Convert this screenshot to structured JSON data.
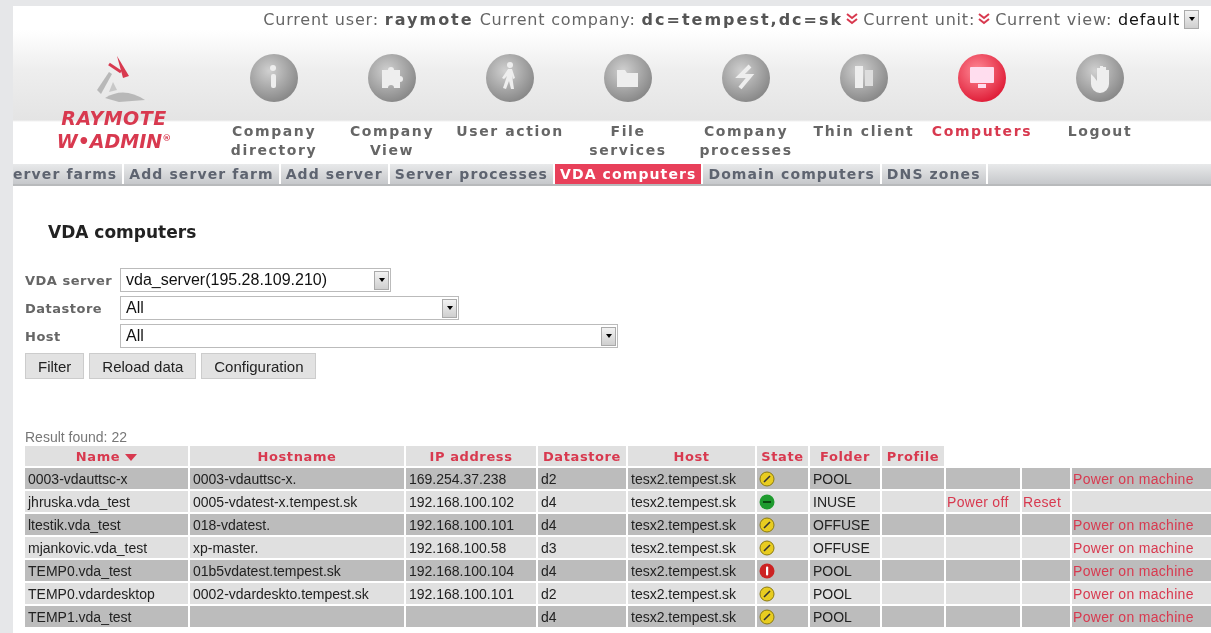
{
  "header": {
    "user_label": "Current user:",
    "user": "raymote",
    "company_label": "Current company:",
    "company": "dc=tempest,dc=sk",
    "unit_label": "Current unit:",
    "view_label": "Current view:",
    "view": "default"
  },
  "logo": {
    "line1": "RAYMOTE",
    "line2": "W•ADMIN",
    "mark": "®"
  },
  "nav": [
    {
      "label": "Company directory",
      "selected": false
    },
    {
      "label": "Company View",
      "selected": false
    },
    {
      "label": "User action",
      "selected": false
    },
    {
      "label": "File services",
      "selected": false
    },
    {
      "label": "Company processes",
      "selected": false
    },
    {
      "label": "Thin client",
      "selected": false
    },
    {
      "label": "Computers",
      "selected": true
    },
    {
      "label": "Logout",
      "selected": false
    }
  ],
  "subnav": [
    {
      "label": "erver farms",
      "selected": false
    },
    {
      "label": "Add server farm",
      "selected": false
    },
    {
      "label": "Add server",
      "selected": false
    },
    {
      "label": "Server processes",
      "selected": false
    },
    {
      "label": "VDA computers",
      "selected": true
    },
    {
      "label": "Domain computers",
      "selected": false
    },
    {
      "label": "DNS zones",
      "selected": false
    }
  ],
  "title": "VDA computers",
  "filters": [
    {
      "label": "VDA server",
      "value": "vda_server(195.28.109.210)"
    },
    {
      "label": "Datastore",
      "value": "All"
    },
    {
      "label": "Host",
      "value": "All"
    }
  ],
  "buttons": [
    "Filter",
    "Reload data",
    "Configuration"
  ],
  "result": "Result found: 22",
  "table": {
    "columns": [
      {
        "label": "Name",
        "sorted": true
      },
      {
        "label": "Hostname",
        "sorted": false
      },
      {
        "label": "IP address",
        "sorted": false
      },
      {
        "label": "Datastore",
        "sorted": false
      },
      {
        "label": "Host",
        "sorted": false
      },
      {
        "label": "State",
        "sorted": false
      },
      {
        "label": "Folder",
        "sorted": false
      },
      {
        "label": "Profile",
        "sorted": false
      }
    ],
    "rows": [
      {
        "name": "0003-vdauttsc-x",
        "hostname": "0003-vdauttsc-x.",
        "ip": "169.254.37.238",
        "datastore": "d2",
        "host": "tesx2.tempest.sk",
        "kind": "suspended",
        "folder": "POOL",
        "power_on": "Power on machine"
      },
      {
        "name": "jhruska.vda_test",
        "hostname": "0005-vdatest-x.tempest.sk",
        "ip": "192.168.100.102",
        "datastore": "d4",
        "host": "tesx2.tempest.sk",
        "kind": "running",
        "folder": "INUSE",
        "power_off": "Power off",
        "reset": "Reset"
      },
      {
        "name": "ltestik.vda_test",
        "hostname": "018-vdatest.",
        "ip": "192.168.100.101",
        "datastore": "d4",
        "host": "tesx2.tempest.sk",
        "kind": "suspended",
        "folder": "OFFUSE",
        "power_on": "Power on machine"
      },
      {
        "name": "mjankovic.vda_test",
        "hostname": "xp-master.",
        "ip": "192.168.100.58",
        "datastore": "d3",
        "host": "tesx2.tempest.sk",
        "kind": "suspended",
        "folder": "OFFUSE",
        "power_on": "Power on machine"
      },
      {
        "name": "TEMP0.vda_test",
        "hostname": "01b5vdatest.tempest.sk",
        "ip": "192.168.100.104",
        "datastore": "d4",
        "host": "tesx2.tempest.sk",
        "kind": "error",
        "folder": "POOL",
        "power_on": "Power on machine"
      },
      {
        "name": "TEMP0.vdardesktop",
        "hostname": "0002-vdardeskto.tempest.sk",
        "ip": "192.168.100.101",
        "datastore": "d2",
        "host": "tesx2.tempest.sk",
        "kind": "suspended",
        "folder": "POOL",
        "power_on": "Power on machine"
      },
      {
        "name": "TEMP1.vda_test",
        "datastore": "d4",
        "host": "tesx2.tempest.sk",
        "kind": "suspended",
        "folder": "POOL",
        "power_on": "Power on machine"
      }
    ]
  }
}
